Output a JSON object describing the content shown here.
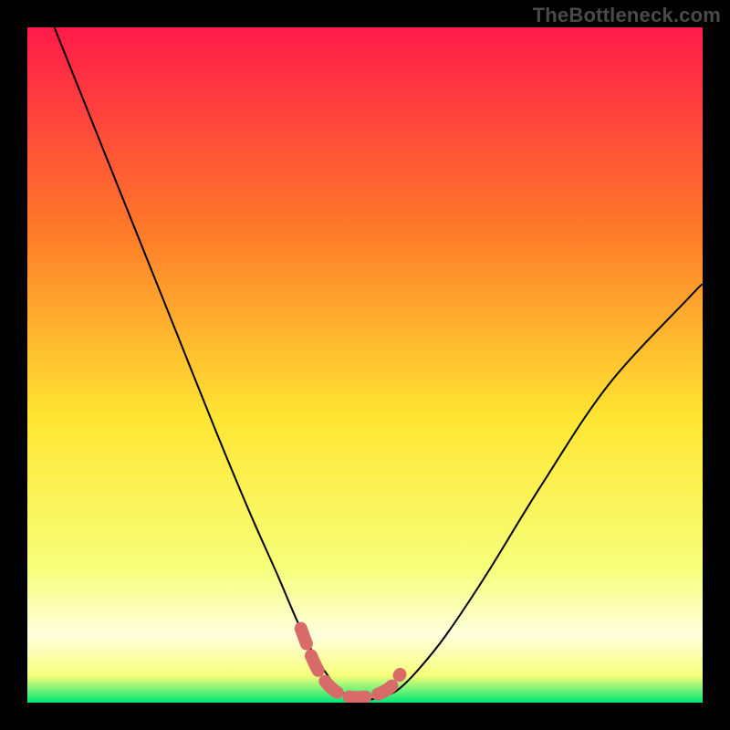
{
  "watermark": "TheBottleneck.com",
  "chart_data": {
    "type": "line",
    "title": "",
    "xlabel": "",
    "ylabel": "",
    "xlim": [
      0,
      100
    ],
    "ylim": [
      0,
      100
    ],
    "background_gradient": {
      "top": "#ff1a4a",
      "upper_mid": "#ff7a2a",
      "mid": "#ffe633",
      "lower_mid": "#f7ff7a",
      "band": "#ffffdd",
      "bottom": "#00e676"
    },
    "series": [
      {
        "name": "bottleneck-curve",
        "color": "#000000",
        "stroke_width": 2,
        "x": [
          4,
          10,
          16,
          22,
          28,
          33,
          37,
          40,
          42.5,
          44.5,
          46,
          47.5,
          49,
          51,
          53,
          55,
          58,
          62,
          68,
          76,
          86,
          98,
          100
        ],
        "y": [
          100,
          85,
          70,
          55,
          40,
          28,
          19,
          12,
          7,
          4,
          2,
          1,
          0.5,
          0.5,
          1,
          2,
          5,
          10,
          19,
          32,
          47,
          60,
          62
        ]
      },
      {
        "name": "marker-overlay",
        "color": "#d96a6a",
        "stroke_width": 10,
        "x": [
          40.5,
          42,
          43.5,
          45,
          46.5,
          48,
          49.5,
          51,
          52.5,
          54,
          55.2
        ],
        "y": [
          11,
          7,
          4,
          2.2,
          1.2,
          0.8,
          0.8,
          1.0,
          1.5,
          2.5,
          4.2
        ]
      }
    ],
    "frame": {
      "color": "#000000",
      "thickness": 30
    }
  }
}
